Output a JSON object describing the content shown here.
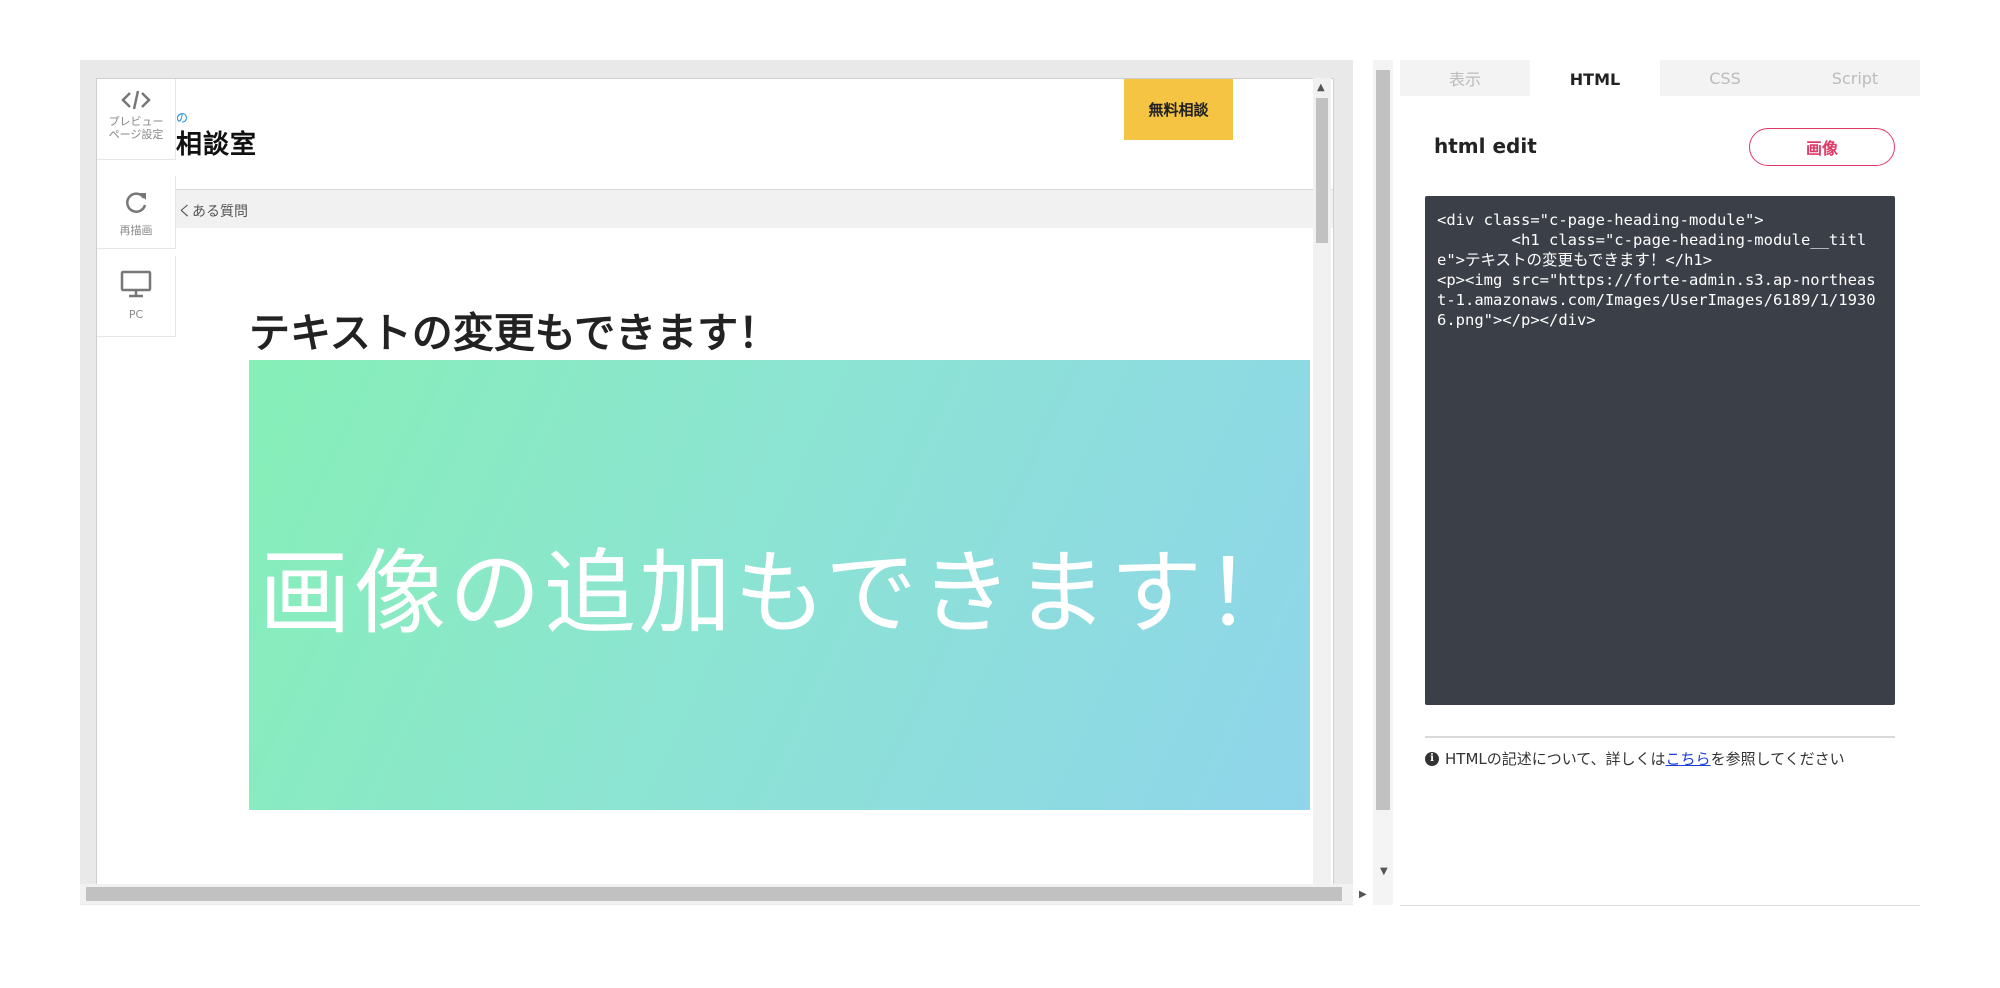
{
  "preview": {
    "logo_small": "の",
    "logo_main": "相談室",
    "cta_label": "無料相談",
    "breadcrumb": "よくある質問",
    "page_title": "テキストの変更もできます！",
    "banner_text": "画像の追加もできます！",
    "tools": [
      {
        "label": "プレビュー\nページ設定",
        "icon": "code-icon"
      },
      {
        "label": "再描画",
        "icon": "refresh-icon"
      },
      {
        "label": "PC",
        "icon": "monitor-icon"
      }
    ]
  },
  "editor": {
    "tabs": [
      {
        "label": "表示",
        "active": false
      },
      {
        "label": "HTML",
        "active": true
      },
      {
        "label": "CSS",
        "active": false
      },
      {
        "label": "Script",
        "active": false
      }
    ],
    "title": "html edit",
    "image_button": "画像",
    "code": "<div class=\"c-page-heading-module\">\n        <h1 class=\"c-page-heading-module__title\">テキストの変更もできます！</h1>\n<p><img src=\"https://forte-admin.s3.ap-northeast-1.amazonaws.com/Images/UserImages/6189/1/19306.png\"></p></div>",
    "help_prefix": "HTMLの記述について、詳しくは",
    "help_link": "こちら",
    "help_suffix": "を参照してください"
  },
  "colors": {
    "cta": "#f5c442",
    "accent_pink": "#e03a68",
    "code_bg": "#3b3f48",
    "banner_start": "#86efb7",
    "banner_end": "#8fd5eb"
  }
}
